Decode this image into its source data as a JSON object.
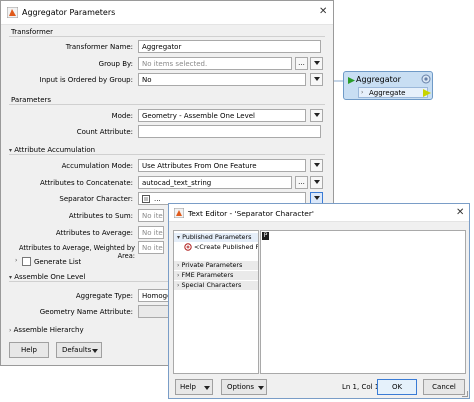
{
  "main_dialog": {
    "title": "Aggregator Parameters",
    "sections": {
      "transformer": "Transformer",
      "parameters": "Parameters",
      "attribute_accumulation": "Attribute Accumulation",
      "assemble_one_level": "Assemble One Level",
      "assemble_hierarchy": "Assemble Hierarchy"
    },
    "fields": {
      "transformer_name": {
        "label": "Transformer Name:",
        "value": "Aggregator"
      },
      "group_by": {
        "label": "Group By:",
        "placeholder": "No items selected."
      },
      "input_ordered": {
        "label": "Input is Ordered by Group:",
        "value": "No"
      },
      "mode": {
        "label": "Mode:",
        "value": "Geometry - Assemble One Level"
      },
      "count_attribute": {
        "label": "Count Attribute:",
        "value": ""
      },
      "accumulation_mode": {
        "label": "Accumulation Mode:",
        "value": "Use Attributes From One Feature"
      },
      "attributes_concatenate": {
        "label": "Attributes to Concatenate:",
        "value": "autocad_text_string"
      },
      "separator_character": {
        "label": "Separator Character:",
        "value": "..."
      },
      "attributes_sum": {
        "label": "Attributes to Sum:",
        "placeholder": "No items"
      },
      "attributes_average": {
        "label": "Attributes to Average:",
        "placeholder": "No items"
      },
      "attributes_weighted": {
        "label": "Attributes to Average, Weighted by Area:",
        "placeholder": "No items"
      },
      "generate_list": {
        "label": "Generate List"
      },
      "aggregate_type": {
        "label": "Aggregate Type:",
        "value": "Homogen"
      },
      "geometry_name": {
        "label": "Geometry Name Attribute:",
        "value": ""
      }
    },
    "buttons": {
      "ellipsis": "...",
      "help": "Help",
      "defaults": "Defaults"
    }
  },
  "canvas": {
    "node_title": "Aggregator",
    "port_label": "Aggregate",
    "colors": {
      "node_fill": "#c8def3",
      "port_out": "#c8d400"
    }
  },
  "text_editor": {
    "title": "Text Editor - 'Separator Character'",
    "tree": {
      "published": "Published Parameters",
      "create_published": "<Create Published P",
      "private": "Private Parameters",
      "fme": "FME Parameters",
      "special": "Special Characters"
    },
    "editor_token": "P",
    "status": "Ln 1, Col 1",
    "buttons": {
      "help": "Help",
      "options": "Options",
      "ok": "OK",
      "cancel": "Cancel"
    }
  }
}
